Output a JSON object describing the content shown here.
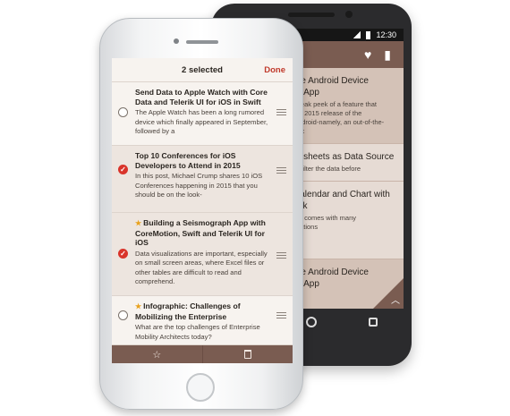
{
  "colors": {
    "accent": "#c0392b",
    "brand": "#7a5c51",
    "check_on": "#d9342b",
    "star": "#e8a21e"
  },
  "android": {
    "status_time": "12:30",
    "toolbar_icons": [
      "heart-icon",
      "trash-icon"
    ],
    "items": [
      {
        "title": "the Android Device\nur App",
        "desc": "sneak peek of a feature that\nQ1 2015 release of the\nAndroid-namely, an out-of-the-box"
      },
      {
        "title": "adsheets as Data Source",
        "desc": "to filter the data before"
      },
      {
        "title": "Calendar and Chart with\nack",
        "desc": "k 1 comes with many\nlizations"
      },
      {
        "title": "the Android Device\nur App",
        "desc": ""
      }
    ],
    "nav_icons": [
      "back-icon",
      "home-icon",
      "recent-apps-icon"
    ]
  },
  "iphone": {
    "header": {
      "title": "2 selected",
      "done_label": "Done"
    },
    "items": [
      {
        "title": "Send Data to Apple Watch with Core Data and Telerik UI for iOS in Swift",
        "desc": "The Apple Watch has been a long rumored device which finally appeared in September, followed by a",
        "selected": false,
        "starred": false
      },
      {
        "title": "Top 10 Conferences for iOS Developers to Attend in 2015",
        "desc": "In this post, Michael Crump shares 10 iOS Conferences happening in 2015 that you should be on the look-",
        "selected": true,
        "starred": false
      },
      {
        "title": "Building a Seismograph App with CoreMotion, Swift and Telerik UI for iOS",
        "desc": "Data visualizations are important, especially on small screen areas, where Excel files or other tables are difficult to read and comprehend.",
        "selected": true,
        "starred": true
      },
      {
        "title": "Infographic: Challenges of Mobilizing the Enterprise",
        "desc": "What are the top challenges of Enterprise Mobility Architects today?",
        "selected": false,
        "starred": true
      }
    ],
    "toolbar": {
      "star_icon": "☆",
      "delete_icon": "trash-icon"
    }
  }
}
